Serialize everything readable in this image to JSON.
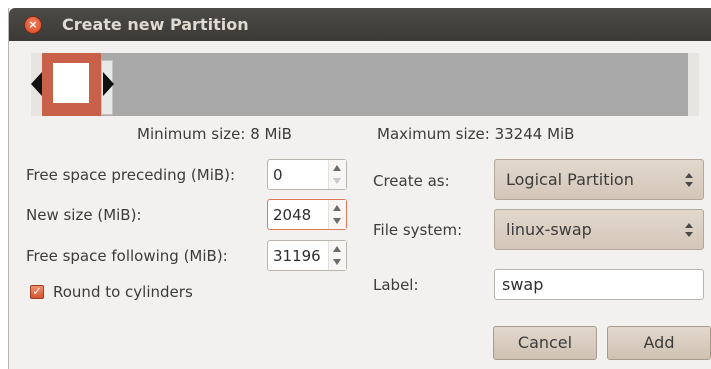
{
  "window": {
    "title": "Create new Partition",
    "close_glyph": "×"
  },
  "partition_bar": {
    "partition_fraction": 0.06,
    "partition_color": "#c9604a"
  },
  "sizes": {
    "minimum": "Minimum size: 8 MiB",
    "maximum": "Maximum size: 33244 MiB"
  },
  "fields": {
    "free_preceding": {
      "label": "Free space preceding (MiB):",
      "value": "0"
    },
    "new_size": {
      "label": "New size (MiB):",
      "value": "2048"
    },
    "free_following": {
      "label": "Free space following (MiB):",
      "value": "31196"
    },
    "round_to_cylinders": {
      "label": "Round to cylinders",
      "checked": true
    }
  },
  "create_as": {
    "label": "Create as:",
    "value": "Logical Partition"
  },
  "file_system": {
    "label": "File system:",
    "value": "linux-swap"
  },
  "partition_label": {
    "label": "Label:",
    "value": "swap"
  },
  "buttons": {
    "cancel": "Cancel",
    "add": "Add"
  },
  "colors": {
    "accent": "#d9482a",
    "titlebar": "#3c3b37",
    "dialog_bg": "#f2f1f0"
  }
}
